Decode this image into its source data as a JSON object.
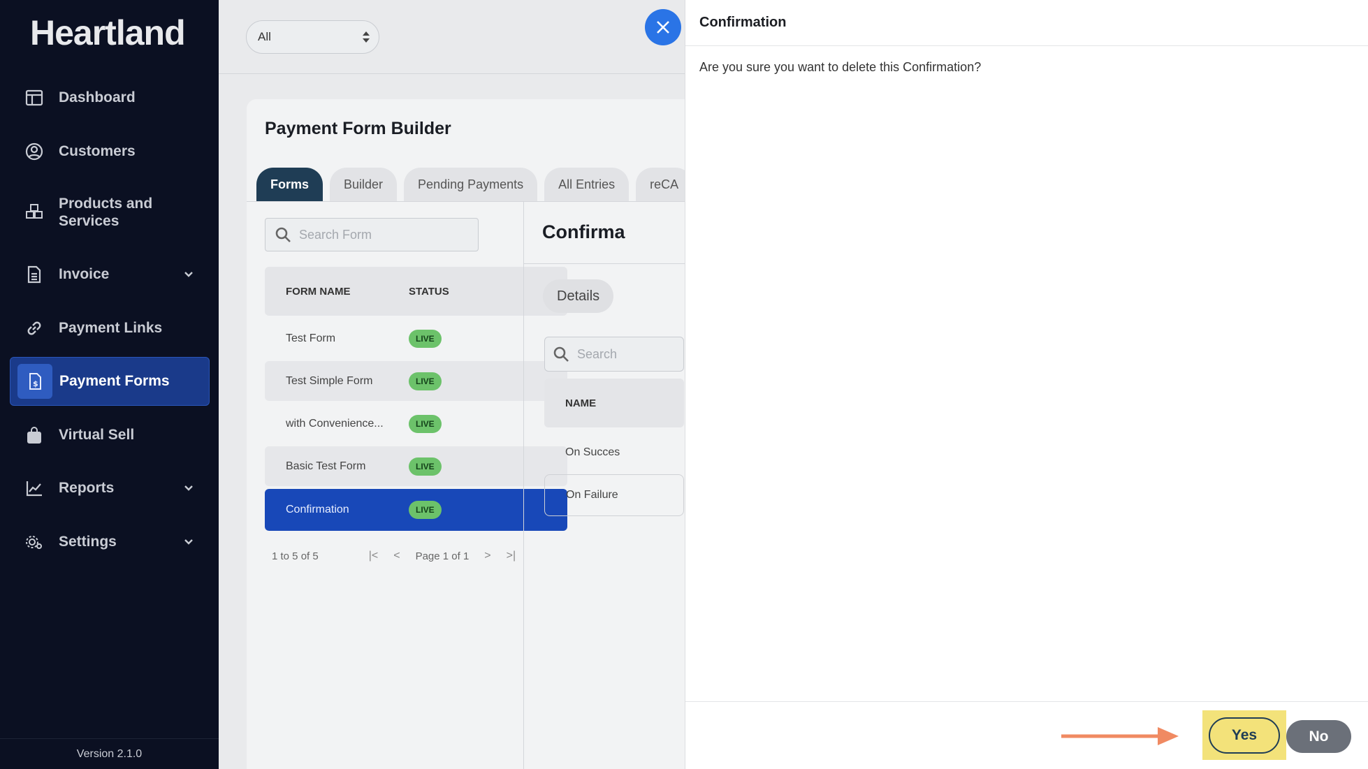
{
  "sidebar": {
    "logo": "Heartland",
    "items": [
      {
        "label": "Dashboard",
        "icon": "dashboard-icon"
      },
      {
        "label": "Customers",
        "icon": "user-circle-icon"
      },
      {
        "label": "Products and Services",
        "icon": "boxes-icon"
      },
      {
        "label": "Invoice",
        "icon": "invoice-icon"
      },
      {
        "label": "Payment Links",
        "icon": "link-icon"
      },
      {
        "label": "Payment Forms",
        "icon": "payment-form-icon",
        "active": true
      },
      {
        "label": "Virtual Sell",
        "icon": "shopping-bag-icon"
      },
      {
        "label": "Reports",
        "icon": "chart-line-icon"
      },
      {
        "label": "Settings",
        "icon": "gear-icon"
      }
    ],
    "version": "Version 2.1.0"
  },
  "topbar": {
    "filter_value": "All"
  },
  "builder": {
    "title": "Payment Form Builder",
    "tabs": [
      "Forms",
      "Builder",
      "Pending Payments",
      "All Entries",
      "reCA"
    ],
    "search_placeholder": "Search Form",
    "table": {
      "headers": [
        "FORM NAME",
        "STATUS"
      ],
      "rows": [
        {
          "name": "Test Form",
          "status": "LIVE"
        },
        {
          "name": "Test Simple Form",
          "status": "LIVE"
        },
        {
          "name": "with Convenience...",
          "status": "LIVE"
        },
        {
          "name": "Basic Test Form",
          "status": "LIVE"
        },
        {
          "name": "Confirmation",
          "status": "LIVE",
          "selected": true
        }
      ]
    },
    "pager": {
      "range": "1 to 5 of 5",
      "page": "Page 1 of 1"
    },
    "detail": {
      "title": "Confirma",
      "tab": "Details",
      "search_placeholder": "Search",
      "header": "NAME",
      "rows": [
        "On Succes",
        "On Failure"
      ]
    }
  },
  "dialog": {
    "title": "Confirmation",
    "message": "Are you sure you want to delete this Confirmation?",
    "yes_label": "Yes",
    "no_label": "No"
  },
  "colors": {
    "sidebar_bg": "#0b1022",
    "active_nav": "#1a3a8a",
    "tab_active": "#1f3d55",
    "selected_row": "#1848b8",
    "badge_live": "#6cc26a",
    "close_button": "#2a74e6",
    "highlight": "#f3e27a",
    "arrow": "#f08a62",
    "no_button": "#6b7079"
  }
}
